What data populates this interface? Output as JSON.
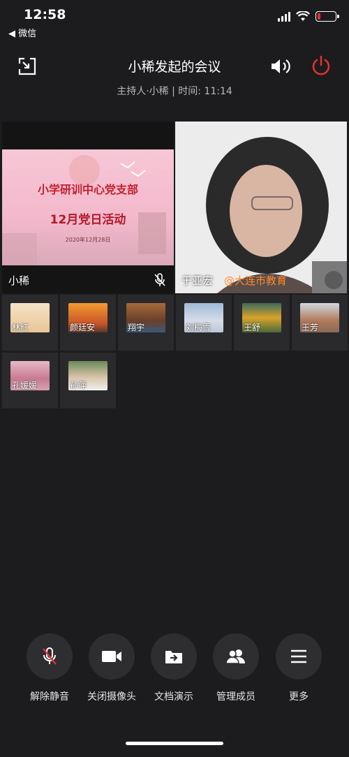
{
  "status_bar": {
    "time": "12:58",
    "back_app": "◀ 微信"
  },
  "header": {
    "title": "小稀发起的会议",
    "subtitle": "主持人·小稀 | 时间: 11:14"
  },
  "main_videos": [
    {
      "name": "小稀",
      "slide": {
        "line1": "小学研训中心党支部",
        "line2": "12月党日活动",
        "date": "2020年12月28日"
      }
    },
    {
      "name": "于亚宏",
      "watermark": "@大连市教育"
    }
  ],
  "participants": [
    {
      "name": "林红"
    },
    {
      "name": "颜廷安"
    },
    {
      "name": "翔宇"
    },
    {
      "name": "刘梅雪"
    },
    {
      "name": "王舒"
    },
    {
      "name": "王芳"
    },
    {
      "name": "孔媛媛"
    },
    {
      "name": "孙萍"
    }
  ],
  "controls": [
    {
      "label": "解除静音",
      "icon": "mic-muted-icon"
    },
    {
      "label": "关闭摄像头",
      "icon": "video-camera-icon"
    },
    {
      "label": "文档演示",
      "icon": "document-share-icon"
    },
    {
      "label": "管理成员",
      "icon": "members-icon"
    },
    {
      "label": "更多",
      "icon": "menu-icon"
    }
  ],
  "colors": {
    "background": "#1c1c1e",
    "accent_red": "#e0312f",
    "watermark": "#ff8a2a"
  }
}
